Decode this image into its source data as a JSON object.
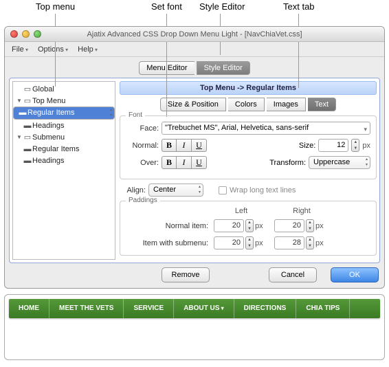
{
  "annotations": {
    "a": "Top menu",
    "b": "Set font",
    "c": "Style Editor",
    "d": "Text tab"
  },
  "window_title": "Ajatix Advanced CSS Drop Down Menu Light - [NavChiaVet.css]",
  "menubar": {
    "file": "File",
    "options": "Options",
    "help": "Help"
  },
  "maintabs": {
    "menu_editor": "Menu Editor",
    "style_editor": "Style Editor"
  },
  "tree": {
    "global": "Global",
    "top_menu": "Top Menu",
    "regular_items": "Regular Items",
    "headings": "Headings",
    "submenu": "Submenu"
  },
  "breadcrumb": "Top Menu -> Regular Items",
  "subtabs": {
    "size": "Size & Position",
    "colors": "Colors",
    "images": "Images",
    "text": "Text"
  },
  "font": {
    "legend": "Font",
    "face_label": "Face:",
    "face_value": "\"Trebuchet MS\", Arial, Helvetica, sans-serif",
    "normal_label": "Normal:",
    "over_label": "Over:",
    "bold": "B",
    "italic": "I",
    "underline": "U",
    "size_label": "Size:",
    "size_value": "12",
    "size_unit": "px",
    "transform_label": "Transform:",
    "transform_value": "Uppercase"
  },
  "align": {
    "label": "Align:",
    "value": "Center",
    "wrap_label": "Wrap long text lines"
  },
  "paddings": {
    "legend": "Paddings",
    "left": "Left",
    "right": "Right",
    "normal_item": "Normal item:",
    "item_submenu": "Item with submenu:",
    "n_left": "20",
    "n_right": "20",
    "s_left": "20",
    "s_right": "28",
    "unit": "px"
  },
  "buttons": {
    "remove": "Remove",
    "cancel": "Cancel",
    "ok": "OK"
  },
  "nav": {
    "home": "HOME",
    "vets": "MEET THE VETS",
    "service": "SERVICE",
    "about": "ABOUT US",
    "directions": "DIRECTIONS",
    "tips": "CHIA TIPS"
  }
}
